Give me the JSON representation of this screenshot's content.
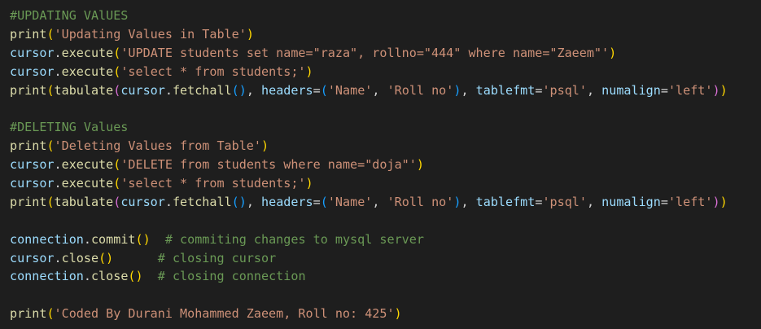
{
  "editor": {
    "colors": {
      "background": "#1e1e1e",
      "comment": "#6a9955",
      "function": "#dcdcaa",
      "variable": "#9cdcfe",
      "string": "#ce9178",
      "punctuation": "#d4d4d4",
      "bracket_level_1": "#ffd700",
      "bracket_level_2": "#da70d6",
      "bracket_level_3": "#179fff"
    },
    "lines": [
      [
        [
          "c",
          "#UPDATING VAlUES"
        ]
      ],
      [
        [
          "f",
          "print"
        ],
        [
          "p1",
          "("
        ],
        [
          "s",
          "'Updating Values in Table'"
        ],
        [
          "p1",
          ")"
        ]
      ],
      [
        [
          "v",
          "cursor"
        ],
        [
          "o",
          "."
        ],
        [
          "f",
          "execute"
        ],
        [
          "p1",
          "("
        ],
        [
          "s",
          "'UPDATE students set name=\"raza\", rollno=\"444\" where name=\"Zaeem\"'"
        ],
        [
          "p1",
          ")"
        ]
      ],
      [
        [
          "v",
          "cursor"
        ],
        [
          "o",
          "."
        ],
        [
          "f",
          "execute"
        ],
        [
          "p1",
          "("
        ],
        [
          "s",
          "'select * from students;'"
        ],
        [
          "p1",
          ")"
        ]
      ],
      [
        [
          "f",
          "print"
        ],
        [
          "p1",
          "("
        ],
        [
          "f",
          "tabulate"
        ],
        [
          "p2",
          "("
        ],
        [
          "v",
          "cursor"
        ],
        [
          "o",
          "."
        ],
        [
          "f",
          "fetchall"
        ],
        [
          "p3",
          "()"
        ],
        [
          "o",
          ", "
        ],
        [
          "v",
          "headers"
        ],
        [
          "o",
          "="
        ],
        [
          "p3",
          "("
        ],
        [
          "s",
          "'Name'"
        ],
        [
          "o",
          ", "
        ],
        [
          "s",
          "'Roll no'"
        ],
        [
          "p3",
          ")"
        ],
        [
          "o",
          ", "
        ],
        [
          "v",
          "tablefmt"
        ],
        [
          "o",
          "="
        ],
        [
          "s",
          "'psql'"
        ],
        [
          "o",
          ", "
        ],
        [
          "v",
          "numalign"
        ],
        [
          "o",
          "="
        ],
        [
          "s",
          "'left'"
        ],
        [
          "p2",
          ")"
        ],
        [
          "p1",
          ")"
        ]
      ],
      [],
      [
        [
          "c",
          "#DELETING Values"
        ]
      ],
      [
        [
          "f",
          "print"
        ],
        [
          "p1",
          "("
        ],
        [
          "s",
          "'Deleting Values from Table'"
        ],
        [
          "p1",
          ")"
        ]
      ],
      [
        [
          "v",
          "cursor"
        ],
        [
          "o",
          "."
        ],
        [
          "f",
          "execute"
        ],
        [
          "p1",
          "("
        ],
        [
          "s",
          "'DELETE from students where name=\"doja\"'"
        ],
        [
          "p1",
          ")"
        ]
      ],
      [
        [
          "v",
          "cursor"
        ],
        [
          "o",
          "."
        ],
        [
          "f",
          "execute"
        ],
        [
          "p1",
          "("
        ],
        [
          "s",
          "'select * from students;'"
        ],
        [
          "p1",
          ")"
        ]
      ],
      [
        [
          "f",
          "print"
        ],
        [
          "p1",
          "("
        ],
        [
          "f",
          "tabulate"
        ],
        [
          "p2",
          "("
        ],
        [
          "v",
          "cursor"
        ],
        [
          "o",
          "."
        ],
        [
          "f",
          "fetchall"
        ],
        [
          "p3",
          "()"
        ],
        [
          "o",
          ", "
        ],
        [
          "v",
          "headers"
        ],
        [
          "o",
          "="
        ],
        [
          "p3",
          "("
        ],
        [
          "s",
          "'Name'"
        ],
        [
          "o",
          ", "
        ],
        [
          "s",
          "'Roll no'"
        ],
        [
          "p3",
          ")"
        ],
        [
          "o",
          ", "
        ],
        [
          "v",
          "tablefmt"
        ],
        [
          "o",
          "="
        ],
        [
          "s",
          "'psql'"
        ],
        [
          "o",
          ", "
        ],
        [
          "v",
          "numalign"
        ],
        [
          "o",
          "="
        ],
        [
          "s",
          "'left'"
        ],
        [
          "p2",
          ")"
        ],
        [
          "p1",
          ")"
        ]
      ],
      [],
      [
        [
          "v",
          "connection"
        ],
        [
          "o",
          "."
        ],
        [
          "f",
          "commit"
        ],
        [
          "p1",
          "()"
        ],
        [
          "o",
          "  "
        ],
        [
          "c",
          "# commiting changes to mysql server"
        ]
      ],
      [
        [
          "v",
          "cursor"
        ],
        [
          "o",
          "."
        ],
        [
          "f",
          "close"
        ],
        [
          "p1",
          "()"
        ],
        [
          "o",
          "      "
        ],
        [
          "c",
          "# closing cursor"
        ]
      ],
      [
        [
          "v",
          "connection"
        ],
        [
          "o",
          "."
        ],
        [
          "f",
          "close"
        ],
        [
          "p1",
          "()"
        ],
        [
          "o",
          "  "
        ],
        [
          "c",
          "# closing connection"
        ]
      ],
      [],
      [
        [
          "f",
          "print"
        ],
        [
          "p1",
          "("
        ],
        [
          "s",
          "'Coded By Durani Mohammed Zaeem, Roll no: 425'"
        ],
        [
          "p1",
          ")"
        ]
      ]
    ]
  }
}
